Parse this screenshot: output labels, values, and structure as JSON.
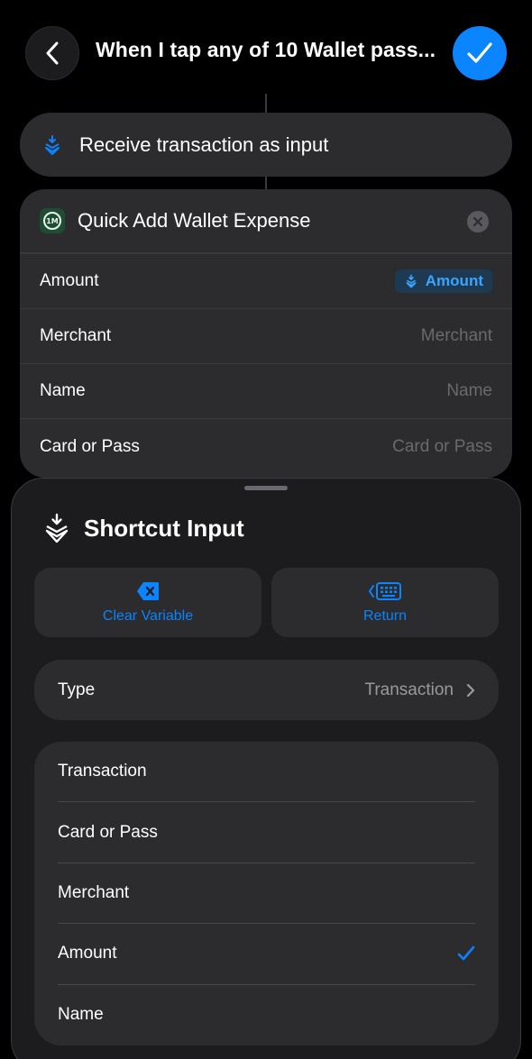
{
  "header": {
    "title": "When I tap any of 10 Wallet pass...",
    "back_icon": "chevron-left-icon",
    "done_icon": "checkmark-icon",
    "accent": "#0a84ff"
  },
  "trigger": {
    "label": "Receive transaction as input",
    "icon": "shortcut-input-icon"
  },
  "action": {
    "title": "Quick Add Wallet Expense",
    "app_icon_text": "1M",
    "params": [
      {
        "label": "Amount",
        "value": "Amount",
        "is_variable": true
      },
      {
        "label": "Merchant",
        "placeholder": "Merchant"
      },
      {
        "label": "Name",
        "placeholder": "Name"
      },
      {
        "label": "Card or Pass",
        "placeholder": "Card or Pass"
      }
    ]
  },
  "sheet": {
    "title": "Shortcut Input",
    "clear_label": "Clear Variable",
    "return_label": "Return",
    "type_label": "Type",
    "type_value": "Transaction",
    "options": [
      {
        "label": "Transaction",
        "selected": false
      },
      {
        "label": "Card or Pass",
        "selected": false
      },
      {
        "label": "Merchant",
        "selected": false
      },
      {
        "label": "Amount",
        "selected": true
      },
      {
        "label": "Name",
        "selected": false
      }
    ]
  }
}
